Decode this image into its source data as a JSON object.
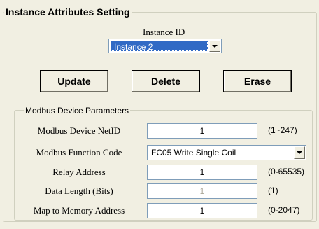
{
  "title": "Instance Attributes Setting",
  "instance": {
    "label": "Instance ID",
    "selected": "Instance  2"
  },
  "buttons": {
    "update": "Update",
    "delete": "Delete",
    "erase": "Erase"
  },
  "group_title": "Modbus Device Parameters",
  "rows": [
    {
      "label": "Modbus Device NetID",
      "value": "1",
      "range": "(1~247)",
      "disabled": false
    },
    {
      "label": "Modbus Function Code",
      "value": "FC05 Write Single Coil",
      "range": "",
      "disabled": false
    },
    {
      "label": "Relay Address",
      "value": "1",
      "range": "(0-65535)",
      "disabled": false
    },
    {
      "label": "Data Length (Bits)",
      "value": "1",
      "range": "(1)",
      "disabled": true
    },
    {
      "label": "Map to Memory Address",
      "value": "1",
      "range": "(0-2047)",
      "disabled": false
    }
  ]
}
